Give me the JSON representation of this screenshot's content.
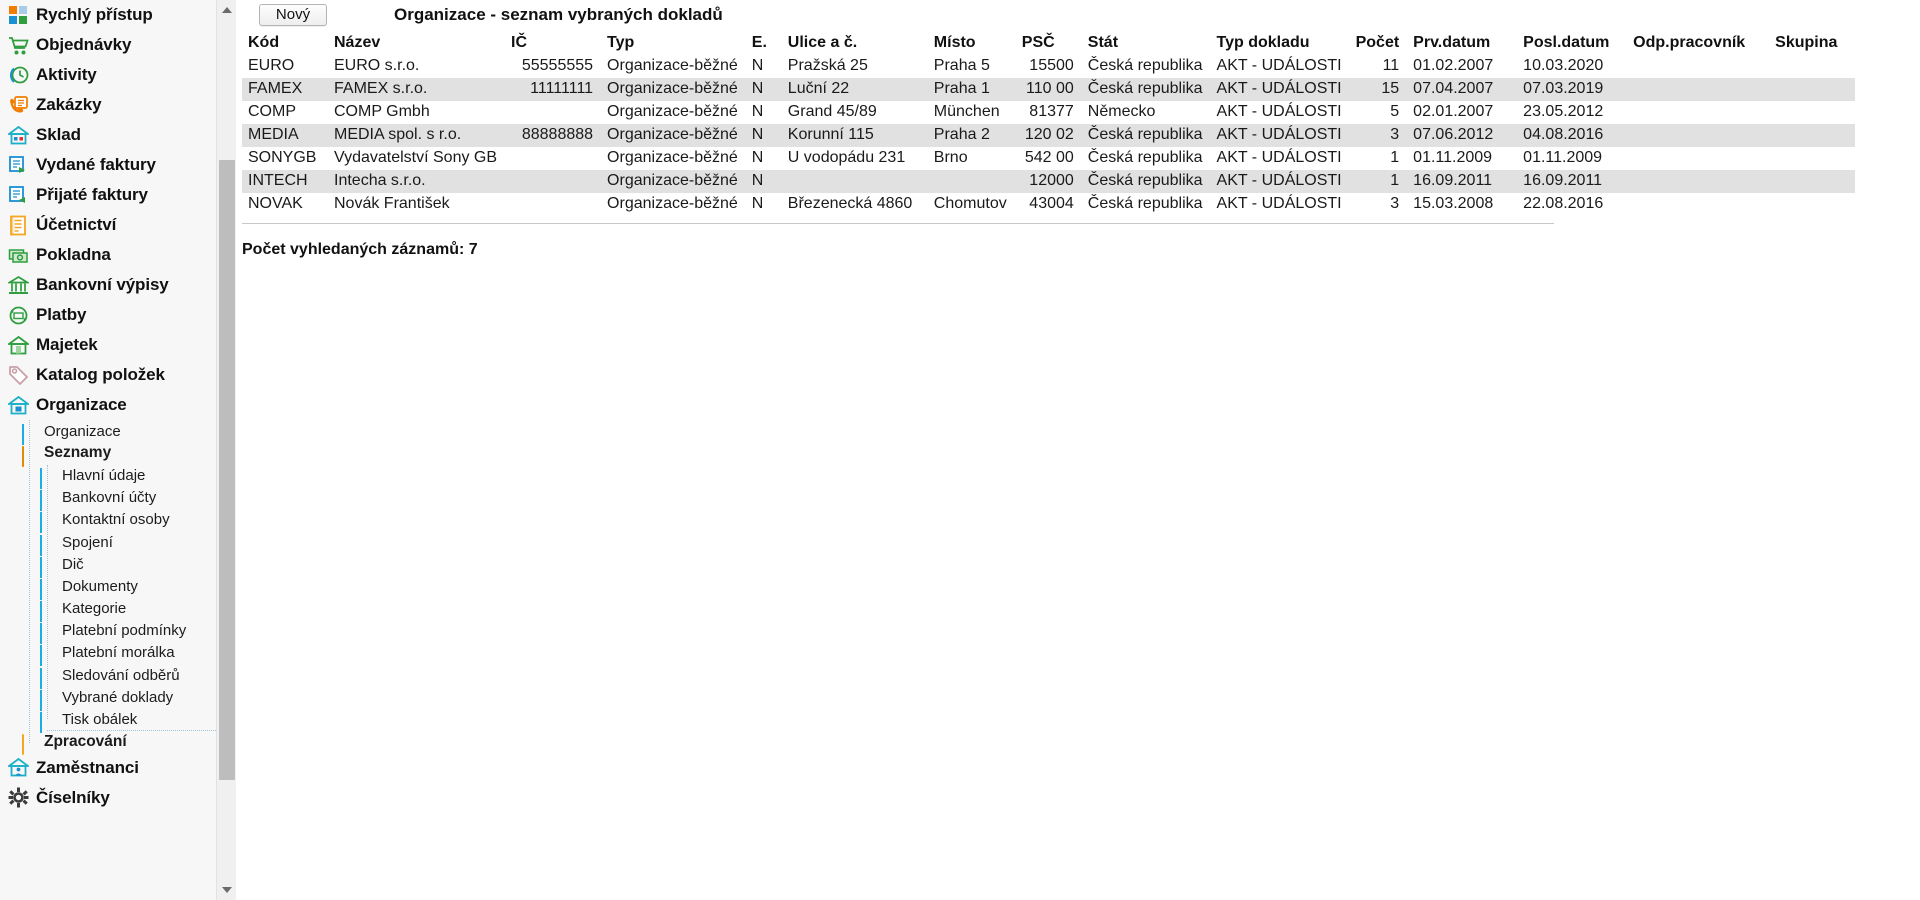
{
  "sidebar": {
    "top_items": [
      {
        "label": "Rychlý přístup",
        "icon": "quick-access-icon"
      },
      {
        "label": "Objednávky",
        "icon": "shopping-cart-icon"
      },
      {
        "label": "Aktivity",
        "icon": "clock-activity-icon"
      },
      {
        "label": "Zakázky",
        "icon": "order-phone-icon"
      },
      {
        "label": "Sklad",
        "icon": "warehouse-house-icon"
      },
      {
        "label": "Vydané faktury",
        "icon": "invoice-out-icon"
      },
      {
        "label": "Přijaté faktury",
        "icon": "invoice-in-icon"
      },
      {
        "label": "Účetnictví",
        "icon": "ledger-book-icon"
      },
      {
        "label": "Pokladna",
        "icon": "cash-money-icon"
      },
      {
        "label": "Bankovní výpisy",
        "icon": "bank-building-icon"
      },
      {
        "label": "Platby",
        "icon": "payments-cycle-icon"
      },
      {
        "label": "Majetek",
        "icon": "property-house-icon"
      },
      {
        "label": "Katalog položek",
        "icon": "catalog-tag-icon"
      },
      {
        "label": "Organizace",
        "icon": "organization-house-icon",
        "expanded": true
      }
    ],
    "organizace_tree": [
      {
        "label": "Organizace",
        "level": 1,
        "icon": "blue-square-icon",
        "bold": false
      },
      {
        "label": "Seznamy",
        "level": 1,
        "icon": "orange-folder-icon",
        "bold": true
      },
      {
        "label": "Hlavní údaje",
        "level": 2,
        "icon": "blue-square-icon",
        "bold": false
      },
      {
        "label": "Bankovní účty",
        "level": 2,
        "icon": "blue-square-icon",
        "bold": false
      },
      {
        "label": "Kontaktní osoby",
        "level": 2,
        "icon": "blue-square-icon",
        "bold": false
      },
      {
        "label": "Spojení",
        "level": 2,
        "icon": "blue-square-icon",
        "bold": false
      },
      {
        "label": "Dič",
        "level": 2,
        "icon": "blue-square-icon",
        "bold": false
      },
      {
        "label": "Dokumenty",
        "level": 2,
        "icon": "blue-square-icon",
        "bold": false
      },
      {
        "label": "Kategorie",
        "level": 2,
        "icon": "blue-square-icon",
        "bold": false
      },
      {
        "label": "Platební podmínky",
        "level": 2,
        "icon": "blue-square-icon",
        "bold": false
      },
      {
        "label": "Platební morálka",
        "level": 2,
        "icon": "blue-square-icon",
        "bold": false
      },
      {
        "label": "Sledování odběrů",
        "level": 2,
        "icon": "blue-square-icon",
        "bold": false
      },
      {
        "label": "Vybrané doklady",
        "level": 2,
        "icon": "blue-square-icon",
        "bold": false
      },
      {
        "label": "Tisk obálek",
        "level": 2,
        "icon": "blue-square-icon",
        "bold": false
      },
      {
        "label": "Zpracování",
        "level": 1,
        "icon": "open-folder-icon",
        "bold": true
      }
    ],
    "bottom_items": [
      {
        "label": "Zaměstnanci",
        "icon": "employees-house-icon"
      },
      {
        "label": "Číselníky",
        "icon": "gear-icon"
      }
    ],
    "scrollbar": {
      "up_arrow": "scroll-up-arrow-icon",
      "down_arrow": "scroll-down-arrow-icon"
    }
  },
  "toolbar": {
    "new_label": "Nový",
    "title": "Organizace - seznam vybraných dokladů"
  },
  "grid": {
    "columns": [
      {
        "key": "kod",
        "label": "Kód"
      },
      {
        "key": "nazev",
        "label": "Název"
      },
      {
        "key": "ic",
        "label": "IČ"
      },
      {
        "key": "typ",
        "label": "Typ"
      },
      {
        "key": "e",
        "label": "E."
      },
      {
        "key": "ulice",
        "label": "Ulice a č."
      },
      {
        "key": "misto",
        "label": "Místo"
      },
      {
        "key": "psc",
        "label": "PSČ"
      },
      {
        "key": "stat",
        "label": "Stát"
      },
      {
        "key": "typdok",
        "label": "Typ dokladu"
      },
      {
        "key": "pocet",
        "label": "Počet"
      },
      {
        "key": "prv",
        "label": "Prv.datum"
      },
      {
        "key": "posl",
        "label": "Posl.datum"
      },
      {
        "key": "odp",
        "label": "Odp.pracovník"
      },
      {
        "key": "skup",
        "label": "Skupina"
      }
    ],
    "rows": [
      {
        "kod": "EURO",
        "nazev": "EURO s.r.o.",
        "ic": "55555555",
        "typ": "Organizace-běžné",
        "e": "N",
        "ulice": "Pražská 25",
        "misto": "Praha 5",
        "psc": "15500",
        "stat": "Česká republika",
        "typdok": "AKT - UDÁLOSTI",
        "pocet": "11",
        "prv": "01.02.2007",
        "posl": "10.03.2020",
        "odp": "",
        "skup": ""
      },
      {
        "kod": "FAMEX",
        "nazev": "FAMEX s.r.o.",
        "ic": "11111111",
        "typ": "Organizace-běžné",
        "e": "N",
        "ulice": "Luční 22",
        "misto": "Praha 1",
        "psc": "110 00",
        "stat": "Česká republika",
        "typdok": "AKT - UDÁLOSTI",
        "pocet": "15",
        "prv": "07.04.2007",
        "posl": "07.03.2019",
        "odp": "",
        "skup": ""
      },
      {
        "kod": "COMP",
        "nazev": "COMP Gmbh",
        "ic": "",
        "typ": "Organizace-běžné",
        "e": "N",
        "ulice": "Grand 45/89",
        "misto": "München",
        "psc": "81377",
        "stat": "Německo",
        "typdok": "AKT - UDÁLOSTI",
        "pocet": "5",
        "prv": "02.01.2007",
        "posl": "23.05.2012",
        "odp": "",
        "skup": ""
      },
      {
        "kod": "MEDIA",
        "nazev": "MEDIA spol. s r.o.",
        "ic": "88888888",
        "typ": "Organizace-běžné",
        "e": "N",
        "ulice": "Korunní 115",
        "misto": "Praha 2",
        "psc": "120 02",
        "stat": "Česká republika",
        "typdok": "AKT - UDÁLOSTI",
        "pocet": "3",
        "prv": "07.06.2012",
        "posl": "04.08.2016",
        "odp": "",
        "skup": ""
      },
      {
        "kod": "SONYGB",
        "nazev": "Vydavatelství Sony GB",
        "ic": "",
        "typ": "Organizace-běžné",
        "e": "N",
        "ulice": "U vodopádu 231",
        "misto": "Brno",
        "psc": "542 00",
        "stat": "Česká republika",
        "typdok": "AKT - UDÁLOSTI",
        "pocet": "1",
        "prv": "01.11.2009",
        "posl": "01.11.2009",
        "odp": "",
        "skup": ""
      },
      {
        "kod": "INTECH",
        "nazev": "Intecha s.r.o.",
        "ic": "",
        "typ": "Organizace-běžné",
        "e": "N",
        "ulice": "",
        "misto": "",
        "psc": "12000",
        "stat": "Česká republika",
        "typdok": "AKT - UDÁLOSTI",
        "pocet": "1",
        "prv": "16.09.2011",
        "posl": "16.09.2011",
        "odp": "",
        "skup": ""
      },
      {
        "kod": "NOVAK",
        "nazev": "Novák František",
        "ic": "",
        "typ": "Organizace-běžné",
        "e": "N",
        "ulice": "Březenecká 4860",
        "misto": "Chomutov",
        "psc": "43004",
        "stat": "Česká republika",
        "typdok": "AKT - UDÁLOSTI",
        "pocet": "3",
        "prv": "15.03.2008",
        "posl": "22.08.2016",
        "odp": "",
        "skup": ""
      }
    ],
    "footer": "Počet vyhledaných záznamů: 7"
  },
  "colors": {
    "row_stripe": "#e1e1e1",
    "sidebar_bg": "#f7f7f7",
    "accent_blue": "#19ade3",
    "accent_orange": "#f5a623",
    "accent_green": "#2e9e3e"
  }
}
